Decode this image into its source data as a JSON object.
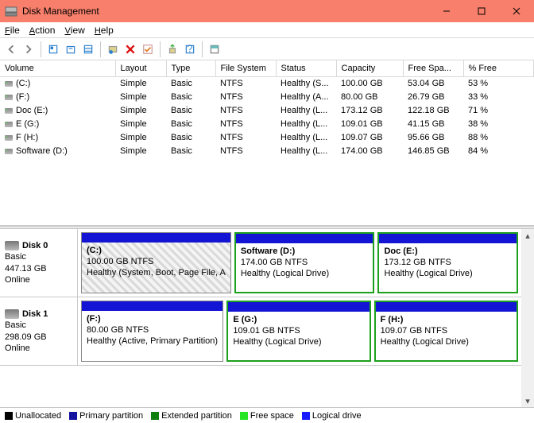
{
  "window": {
    "title": "Disk Management"
  },
  "menu": {
    "file": "File",
    "action": "Action",
    "view": "View",
    "help": "Help"
  },
  "columns": {
    "volume": "Volume",
    "layout": "Layout",
    "type": "Type",
    "fs": "File System",
    "status": "Status",
    "capacity": "Capacity",
    "free": "Free Spa...",
    "pct": "% Free"
  },
  "volumes": [
    {
      "name": "(C:)",
      "layout": "Simple",
      "type": "Basic",
      "fs": "NTFS",
      "status": "Healthy (S...",
      "cap": "100.00 GB",
      "free": "53.04 GB",
      "pct": "53 %"
    },
    {
      "name": "(F:)",
      "layout": "Simple",
      "type": "Basic",
      "fs": "NTFS",
      "status": "Healthy (A...",
      "cap": "80.00 GB",
      "free": "26.79 GB",
      "pct": "33 %"
    },
    {
      "name": "Doc (E:)",
      "layout": "Simple",
      "type": "Basic",
      "fs": "NTFS",
      "status": "Healthy (L...",
      "cap": "173.12 GB",
      "free": "122.18 GB",
      "pct": "71 %"
    },
    {
      "name": "E (G:)",
      "layout": "Simple",
      "type": "Basic",
      "fs": "NTFS",
      "status": "Healthy (L...",
      "cap": "109.01 GB",
      "free": "41.15 GB",
      "pct": "38 %"
    },
    {
      "name": "F (H:)",
      "layout": "Simple",
      "type": "Basic",
      "fs": "NTFS",
      "status": "Healthy (L...",
      "cap": "109.07 GB",
      "free": "95.66 GB",
      "pct": "88 %"
    },
    {
      "name": "Software (D:)",
      "layout": "Simple",
      "type": "Basic",
      "fs": "NTFS",
      "status": "Healthy (L...",
      "cap": "174.00 GB",
      "free": "146.85 GB",
      "pct": "84 %"
    }
  ],
  "disks": [
    {
      "title": "Disk 0",
      "type": "Basic",
      "size": "447.13 GB",
      "state": "Online",
      "parts": [
        {
          "name": "(C:)",
          "line2": "100.00 GB NTFS",
          "line3": "Healthy (System, Boot, Page File, A",
          "sel": false,
          "hatch": true
        },
        {
          "name": "Software  (D:)",
          "line2": "174.00 GB NTFS",
          "line3": "Healthy (Logical Drive)",
          "sel": true,
          "hatch": false
        },
        {
          "name": "Doc  (E:)",
          "line2": "173.12 GB NTFS",
          "line3": "Healthy (Logical Drive)",
          "sel": true,
          "hatch": false
        }
      ]
    },
    {
      "title": "Disk 1",
      "type": "Basic",
      "size": "298.09 GB",
      "state": "Online",
      "parts": [
        {
          "name": "(F:)",
          "line2": "80.00 GB NTFS",
          "line3": "Healthy (Active, Primary Partition)",
          "sel": false,
          "hatch": false
        },
        {
          "name": "E  (G:)",
          "line2": "109.01 GB NTFS",
          "line3": "Healthy (Logical Drive)",
          "sel": true,
          "hatch": false
        },
        {
          "name": "F  (H:)",
          "line2": "109.07 GB NTFS",
          "line3": "Healthy (Logical Drive)",
          "sel": true,
          "hatch": false
        }
      ]
    }
  ],
  "legend": {
    "unallocated": "Unallocated",
    "primary": "Primary partition",
    "extended": "Extended partition",
    "free": "Free space",
    "logical": "Logical drive",
    "colors": {
      "unallocated": "#000000",
      "primary": "#14149e",
      "extended": "#0c7f0c",
      "free": "#28e528",
      "logical": "#1a1aff"
    }
  }
}
